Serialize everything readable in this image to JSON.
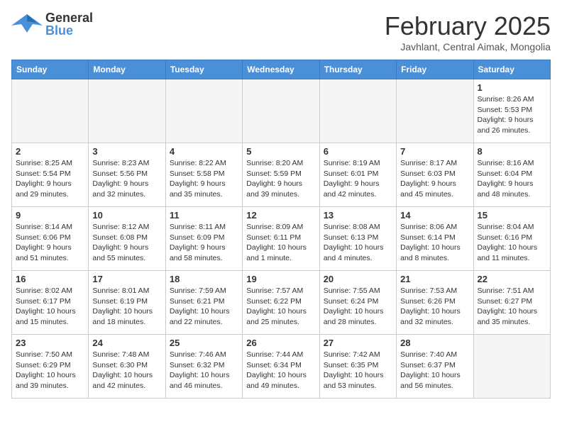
{
  "header": {
    "logo": {
      "general": "General",
      "blue": "Blue"
    },
    "title": "February 2025",
    "subtitle": "Javhlant, Central Aimak, Mongolia"
  },
  "days_of_week": [
    "Sunday",
    "Monday",
    "Tuesday",
    "Wednesday",
    "Thursday",
    "Friday",
    "Saturday"
  ],
  "weeks": [
    [
      {
        "day": "",
        "info": ""
      },
      {
        "day": "",
        "info": ""
      },
      {
        "day": "",
        "info": ""
      },
      {
        "day": "",
        "info": ""
      },
      {
        "day": "",
        "info": ""
      },
      {
        "day": "",
        "info": ""
      },
      {
        "day": "1",
        "info": "Sunrise: 8:26 AM\nSunset: 5:53 PM\nDaylight: 9 hours and 26 minutes."
      }
    ],
    [
      {
        "day": "2",
        "info": "Sunrise: 8:25 AM\nSunset: 5:54 PM\nDaylight: 9 hours and 29 minutes."
      },
      {
        "day": "3",
        "info": "Sunrise: 8:23 AM\nSunset: 5:56 PM\nDaylight: 9 hours and 32 minutes."
      },
      {
        "day": "4",
        "info": "Sunrise: 8:22 AM\nSunset: 5:58 PM\nDaylight: 9 hours and 35 minutes."
      },
      {
        "day": "5",
        "info": "Sunrise: 8:20 AM\nSunset: 5:59 PM\nDaylight: 9 hours and 39 minutes."
      },
      {
        "day": "6",
        "info": "Sunrise: 8:19 AM\nSunset: 6:01 PM\nDaylight: 9 hours and 42 minutes."
      },
      {
        "day": "7",
        "info": "Sunrise: 8:17 AM\nSunset: 6:03 PM\nDaylight: 9 hours and 45 minutes."
      },
      {
        "day": "8",
        "info": "Sunrise: 8:16 AM\nSunset: 6:04 PM\nDaylight: 9 hours and 48 minutes."
      }
    ],
    [
      {
        "day": "9",
        "info": "Sunrise: 8:14 AM\nSunset: 6:06 PM\nDaylight: 9 hours and 51 minutes."
      },
      {
        "day": "10",
        "info": "Sunrise: 8:12 AM\nSunset: 6:08 PM\nDaylight: 9 hours and 55 minutes."
      },
      {
        "day": "11",
        "info": "Sunrise: 8:11 AM\nSunset: 6:09 PM\nDaylight: 9 hours and 58 minutes."
      },
      {
        "day": "12",
        "info": "Sunrise: 8:09 AM\nSunset: 6:11 PM\nDaylight: 10 hours and 1 minute."
      },
      {
        "day": "13",
        "info": "Sunrise: 8:08 AM\nSunset: 6:13 PM\nDaylight: 10 hours and 4 minutes."
      },
      {
        "day": "14",
        "info": "Sunrise: 8:06 AM\nSunset: 6:14 PM\nDaylight: 10 hours and 8 minutes."
      },
      {
        "day": "15",
        "info": "Sunrise: 8:04 AM\nSunset: 6:16 PM\nDaylight: 10 hours and 11 minutes."
      }
    ],
    [
      {
        "day": "16",
        "info": "Sunrise: 8:02 AM\nSunset: 6:17 PM\nDaylight: 10 hours and 15 minutes."
      },
      {
        "day": "17",
        "info": "Sunrise: 8:01 AM\nSunset: 6:19 PM\nDaylight: 10 hours and 18 minutes."
      },
      {
        "day": "18",
        "info": "Sunrise: 7:59 AM\nSunset: 6:21 PM\nDaylight: 10 hours and 22 minutes."
      },
      {
        "day": "19",
        "info": "Sunrise: 7:57 AM\nSunset: 6:22 PM\nDaylight: 10 hours and 25 minutes."
      },
      {
        "day": "20",
        "info": "Sunrise: 7:55 AM\nSunset: 6:24 PM\nDaylight: 10 hours and 28 minutes."
      },
      {
        "day": "21",
        "info": "Sunrise: 7:53 AM\nSunset: 6:26 PM\nDaylight: 10 hours and 32 minutes."
      },
      {
        "day": "22",
        "info": "Sunrise: 7:51 AM\nSunset: 6:27 PM\nDaylight: 10 hours and 35 minutes."
      }
    ],
    [
      {
        "day": "23",
        "info": "Sunrise: 7:50 AM\nSunset: 6:29 PM\nDaylight: 10 hours and 39 minutes."
      },
      {
        "day": "24",
        "info": "Sunrise: 7:48 AM\nSunset: 6:30 PM\nDaylight: 10 hours and 42 minutes."
      },
      {
        "day": "25",
        "info": "Sunrise: 7:46 AM\nSunset: 6:32 PM\nDaylight: 10 hours and 46 minutes."
      },
      {
        "day": "26",
        "info": "Sunrise: 7:44 AM\nSunset: 6:34 PM\nDaylight: 10 hours and 49 minutes."
      },
      {
        "day": "27",
        "info": "Sunrise: 7:42 AM\nSunset: 6:35 PM\nDaylight: 10 hours and 53 minutes."
      },
      {
        "day": "28",
        "info": "Sunrise: 7:40 AM\nSunset: 6:37 PM\nDaylight: 10 hours and 56 minutes."
      },
      {
        "day": "",
        "info": ""
      }
    ]
  ]
}
